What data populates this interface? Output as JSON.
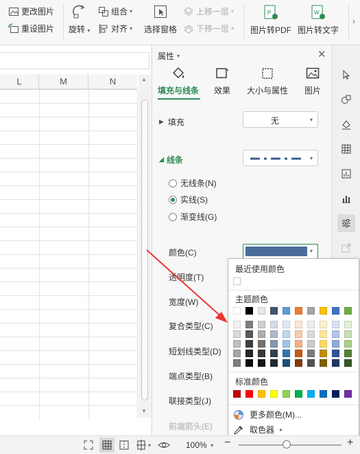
{
  "ribbon": {
    "change_image": "更改图片",
    "reset_image": "重设图片",
    "rotate": "旋转",
    "group": "组合",
    "align": "对齐",
    "selection_pane": "选择窗格",
    "bring_forward": "上移一层",
    "send_backward": "下移一层",
    "to_pdf": "图片转PDF",
    "to_text": "图片转文字"
  },
  "sheet": {
    "columns": [
      "L",
      "M",
      "N"
    ]
  },
  "panel": {
    "title": "属性",
    "tabs": [
      "填充与线条",
      "效果",
      "大小与属性",
      "图片"
    ],
    "fill_label": "填充",
    "fill_value": "无",
    "line_label": "线条",
    "radio_none": "无线条(N)",
    "radio_solid": "实线(S)",
    "radio_gradient": "渐变线(G)",
    "color_label": "颜色(C)",
    "transparency_label": "透明度(T)",
    "width_label": "宽度(W)",
    "compound_label": "复合类型(C)",
    "dash_label": "短划线类型(D)",
    "cap_label": "端点类型(B)",
    "join_label": "联接类型(J)",
    "arrow_label": "前端箭头(E)",
    "selected_color": "#4a6d9a",
    "accent_color": "#2e8b57"
  },
  "color_popup": {
    "recent_title": "最近使用颜色",
    "theme_title": "主题颜色",
    "standard_title": "标准颜色",
    "more_colors": "更多颜色(M)...",
    "picker": "取色器",
    "theme_row": [
      "#ffffff",
      "#000000",
      "#e7e6e6",
      "#44546a",
      "#5b9bd5",
      "#ed7d31",
      "#a5a5a5",
      "#ffc000",
      "#4472c4",
      "#70ad47"
    ],
    "theme_shades": [
      [
        "#f2f2f2",
        "#7f7f7f",
        "#d0cece",
        "#d6dce4",
        "#deebf6",
        "#fbe5d5",
        "#ededed",
        "#fff2cc",
        "#dae3f3",
        "#e2efd9"
      ],
      [
        "#d8d8d8",
        "#595959",
        "#aeabab",
        "#adb9ca",
        "#bdd7ee",
        "#f7cbac",
        "#dbdbdb",
        "#fee599",
        "#b4c6e7",
        "#c5e0b3"
      ],
      [
        "#bfbfbf",
        "#3f3f3f",
        "#757070",
        "#8496b0",
        "#9dc3e6",
        "#f4b183",
        "#c9c9c9",
        "#ffd965",
        "#8eaadb",
        "#a8d08d"
      ],
      [
        "#a5a5a5",
        "#262626",
        "#3a3838",
        "#323f4f",
        "#2e75b5",
        "#c55a11",
        "#7b7b7b",
        "#bf9000",
        "#2f5496",
        "#538135"
      ],
      [
        "#7f7f7f",
        "#0c0c0c",
        "#171616",
        "#222a35",
        "#1e4e79",
        "#833c0b",
        "#525252",
        "#7f6000",
        "#1f3864",
        "#375623"
      ]
    ],
    "standard_row": [
      "#c00000",
      "#ff0000",
      "#ffc000",
      "#ffff00",
      "#92d050",
      "#00b050",
      "#00b0f0",
      "#0070c0",
      "#002060",
      "#7030a0"
    ]
  },
  "status": {
    "zoom": "100%"
  }
}
